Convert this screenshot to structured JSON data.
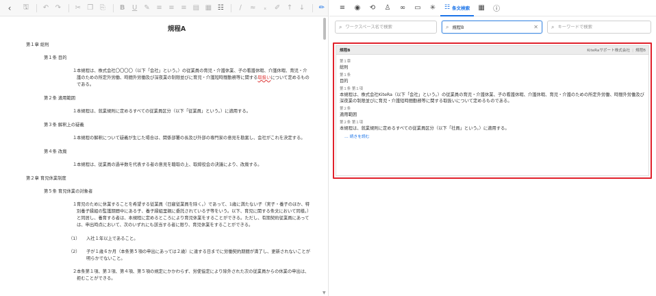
{
  "editor": {
    "toolbar": {
      "icons": [
        "back-icon",
        "save-icon",
        "undo-icon",
        "redo-icon",
        "cut-icon",
        "copy-icon",
        "paste-icon",
        "bold-icon",
        "underline-icon",
        "highlight-icon",
        "align-left-icon",
        "align-center-icon",
        "align-right-icon",
        "table-icon",
        "table-edit-icon",
        "format-icon",
        "link-icon",
        "unlink-icon",
        "subscript-icon",
        "brush-icon",
        "arrow-up-icon",
        "arrow-down-icon",
        "pen-icon"
      ]
    },
    "title": "規程A",
    "chapter1": "第１章 総則",
    "a1_head": "第１条 目的",
    "a1_num": "１",
    "a1_text_pre": "本規程は、株式会社〇〇〇〇（以下「会社」という。）の従業員の育児・介護休業、子の看護休暇、介護休暇、育児・介護のための所定外労働、時間外労働及び深夜業の制限並びに育児・介護短時間勤務等に関する",
    "a1_text_typo": "取扱い",
    "a1_text_post": "について定めるものである。",
    "a2_head": "第２条 適用範囲",
    "a2_num": "１",
    "a2_text": "本規程は、就業規則に定めるすべての従業員区分（以下「従業員」という。）に適用する。",
    "a3_head": "第３条 解釈上の疑義",
    "a3_num": "１",
    "a3_text": "本規程の解釈について疑義が生じた場合は、関係部署の長及び外部の専門家の意見を勘案し、会社がこれを決定する。",
    "a4_head": "第４条 改廃",
    "a4_num": "１",
    "a4_text": "本規程は、従業員の過半数を代表する者の意見を聴取の上、取締役会の決議により、改廃する。",
    "chapter2": "第２章 育児休業制度",
    "a5_head": "第５条 育児休業の対象者",
    "a5_num": "１",
    "a5_text": "育児のために休業することを希望する従業員（日雇従業員を除く。）であって、1歳に満たない子（実子・養子のほか、特別養子縁組の監護期間中にある子、養子縁組里親に委託されている子等をいう。以下、育児に関する条文において同様。）と同居し、養育する者は、本規程に定めるところにより育児休業をすることができる。ただし、有期契約従業員にあっては、申出時点において、次のいずれにも該当する者に限り、育児休業をすることができる。",
    "a5_item1_num": "（1）",
    "a5_item1": "入社１年以上であること。",
    "a5_item2_num": "（2）",
    "a5_item2": "子が１歳６か月（本条第５項の申出にあっては２歳）に達する日までに労働契約期間が満了し、更新されないことが明らかでないこと。",
    "a5_p2_num": "２",
    "a5_p2_text": "本条第１項、第３項、第４項、第５項の規定にかかわらず、労使協定により除外された次の従業員からの休業の申出は、拒むことができる。"
  },
  "panel": {
    "tabs": [
      {
        "icon": "menu-icon",
        "glyph": "≡"
      },
      {
        "icon": "eye-icon",
        "glyph": "◉"
      },
      {
        "icon": "history-icon",
        "glyph": "⟲"
      },
      {
        "icon": "people-icon",
        "glyph": "♙"
      },
      {
        "icon": "link-icon",
        "glyph": "∞"
      },
      {
        "icon": "comment-icon",
        "glyph": "▭"
      },
      {
        "icon": "sparkle-icon",
        "glyph": "✳"
      }
    ],
    "active_tab_label": "条文検索",
    "extra_tabs": [
      {
        "icon": "table-view-icon",
        "glyph": "▦"
      },
      {
        "icon": "info-icon",
        "glyph": "ⓘ"
      }
    ],
    "search": {
      "workspace_placeholder": "ワークスペース名で検索",
      "regulation_value": "規程B",
      "keyword_placeholder": "キーワードで検索"
    },
    "result": {
      "title": "規程B",
      "company": "KiteRaサポート株式会社",
      "regulation": "規程B",
      "blocks": [
        {
          "label": "第１章",
          "value": "総則"
        },
        {
          "label": "第１条",
          "value": "目的"
        },
        {
          "label": "第１条 第１項",
          "value": "本規程は、株式会社KiteRa（以下「会社」という。）の従業員の育児・介護休業、子の看護休暇、介護休暇、育児・介護のための所定外労働、時間外労働及び深夜業の制限並びに育児・介護短時間勤務等に関する取扱いについて定めるものである。"
        },
        {
          "label": "第２条",
          "value": "適用範囲"
        },
        {
          "label": "第２条 第１項",
          "value": "本規程は、就業規則に定めるすべての従業員区分（以下「社員」という。）に適用する。"
        }
      ],
      "more_label": "… 続きを読む"
    }
  }
}
